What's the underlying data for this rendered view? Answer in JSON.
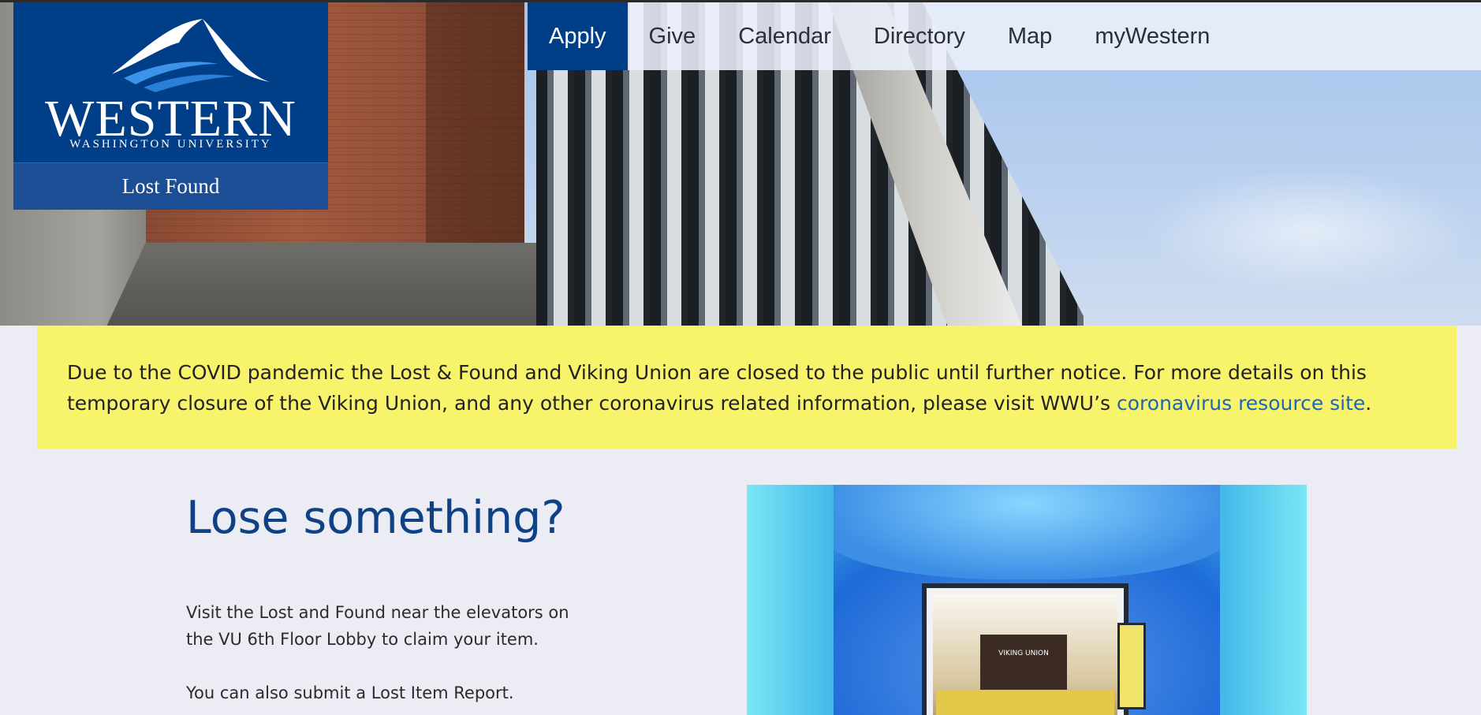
{
  "nav": {
    "items": [
      {
        "label": "Apply",
        "active": true
      },
      {
        "label": "Give",
        "active": false
      },
      {
        "label": "Calendar",
        "active": false
      },
      {
        "label": "Directory",
        "active": false
      },
      {
        "label": "Map",
        "active": false
      },
      {
        "label": "myWestern",
        "active": false
      }
    ]
  },
  "logo": {
    "wordmark": "WESTERN",
    "subtitle": "WASHINGTON UNIVERSITY",
    "site_name": "Lost Found"
  },
  "alert": {
    "text_before": "Due to the COVID pandemic the Lost & Found and Viking Union are closed to the public until further notice. For more details on this temporary closure of the Viking Union, and any other coronavirus related information, please visit WWU’s ",
    "link_text": "coronavirus resource site",
    "text_after": "."
  },
  "main": {
    "heading": "Lose something?",
    "paragraph1": "Visit the Lost and Found near the elevators on the VU 6th Floor Lobby to claim your item.",
    "paragraph2": "You can also submit a Lost Item Report."
  },
  "photo": {
    "poster_text": "VIKING UNION"
  },
  "colors": {
    "brand_blue": "#003f87",
    "alert_yellow": "#f7f36a",
    "link_blue": "#1e66b5",
    "page_bg": "#ecedf4"
  }
}
